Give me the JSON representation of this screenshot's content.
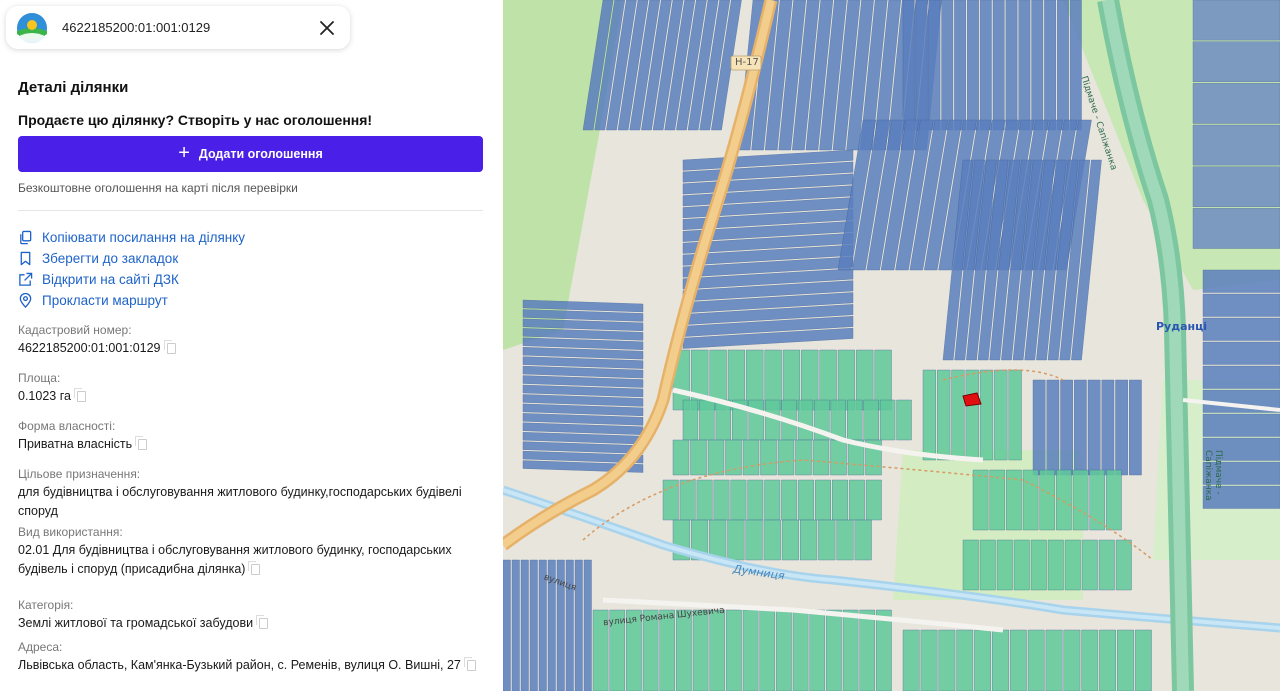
{
  "search": {
    "value": "4622185200:01:001:0129"
  },
  "details": {
    "title": "Деталі ділянки",
    "sell_prompt": "Продаєте цю ділянку? Створіть у нас оголошення!",
    "add_button_label": "Додати оголошення",
    "free_note": "Безкоштовне оголошення на карті після перевірки"
  },
  "actions": [
    {
      "label": "Копіювати посилання на ділянку",
      "icon": "copy-icon"
    },
    {
      "label": "Зберегти до закладок",
      "icon": "bookmark-icon"
    },
    {
      "label": "Відкрити на сайті ДЗК",
      "icon": "external-link-icon"
    },
    {
      "label": "Прокласти маршрут",
      "icon": "map-pin-icon"
    }
  ],
  "fields": [
    {
      "label": "Кадастровий номер:",
      "value": "4622185200:01:001:0129"
    },
    {
      "label": "Площа:",
      "value": "0.1023 га"
    },
    {
      "label": "Форма власності:",
      "value": "Приватна власність"
    },
    {
      "label": "Цільове призначення:",
      "value": "для будівництва і обслуговування житлового будинку,господарських будівелі споруд"
    },
    {
      "label": "Вид використання:",
      "value": "02.01 Для будівництва і обслуговування житлового будинку, господарських будівель і споруд (присадибна ділянка)"
    },
    {
      "label": "Категорія:",
      "value": "Землі житлової та громадської забудови"
    },
    {
      "label": "Адреса:",
      "value": "Львівська область, Кам'янка-Бузький район, с. Ременів, вулиця О. Вишні, 27"
    }
  ],
  "map": {
    "road_label": "Н-17",
    "village_label": "Руданці",
    "river_label": "Думниця",
    "street_label": "вулиця Романа Шухевича",
    "highway_label_1": "Підмаче - Сапіжанка",
    "highway_label_2": "Підмаче - Сапіжанка",
    "street_label_2": "вулиця"
  },
  "colors": {
    "accent": "#4a1fe8",
    "link": "#1e63c9",
    "parcel_blue": "#5b7fbe",
    "parcel_green": "#5fc99a",
    "selected_parcel": "#e01010"
  }
}
